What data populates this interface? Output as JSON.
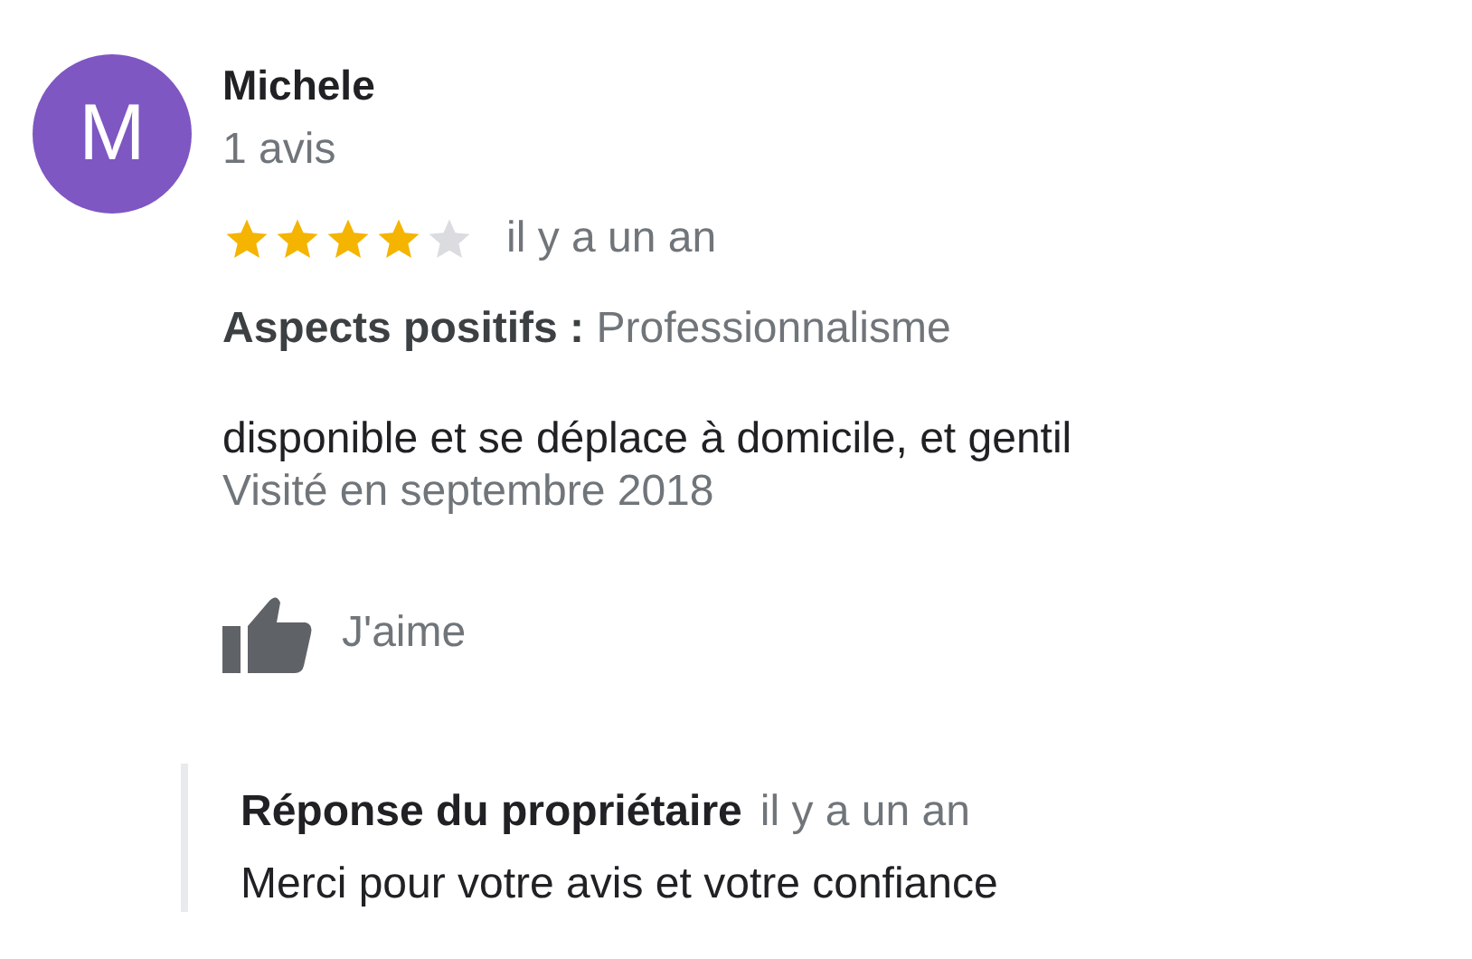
{
  "review": {
    "avatar_letter": "M",
    "author": "Michele",
    "review_count": "1 avis",
    "stars": 4,
    "time": "il y a un an",
    "aspects": "**Aspects positifs :** Professionnalisme",
    "text": "disponible et se déplace à domicile, et gentil",
    "visited": "Visité en septembre 2018",
    "like_label": "J'aime"
  },
  "owner_reply": {
    "title": "Réponse du propriétaire",
    "time": "il y a un an",
    "text": "Merci pour votre avis et votre confiance"
  }
}
